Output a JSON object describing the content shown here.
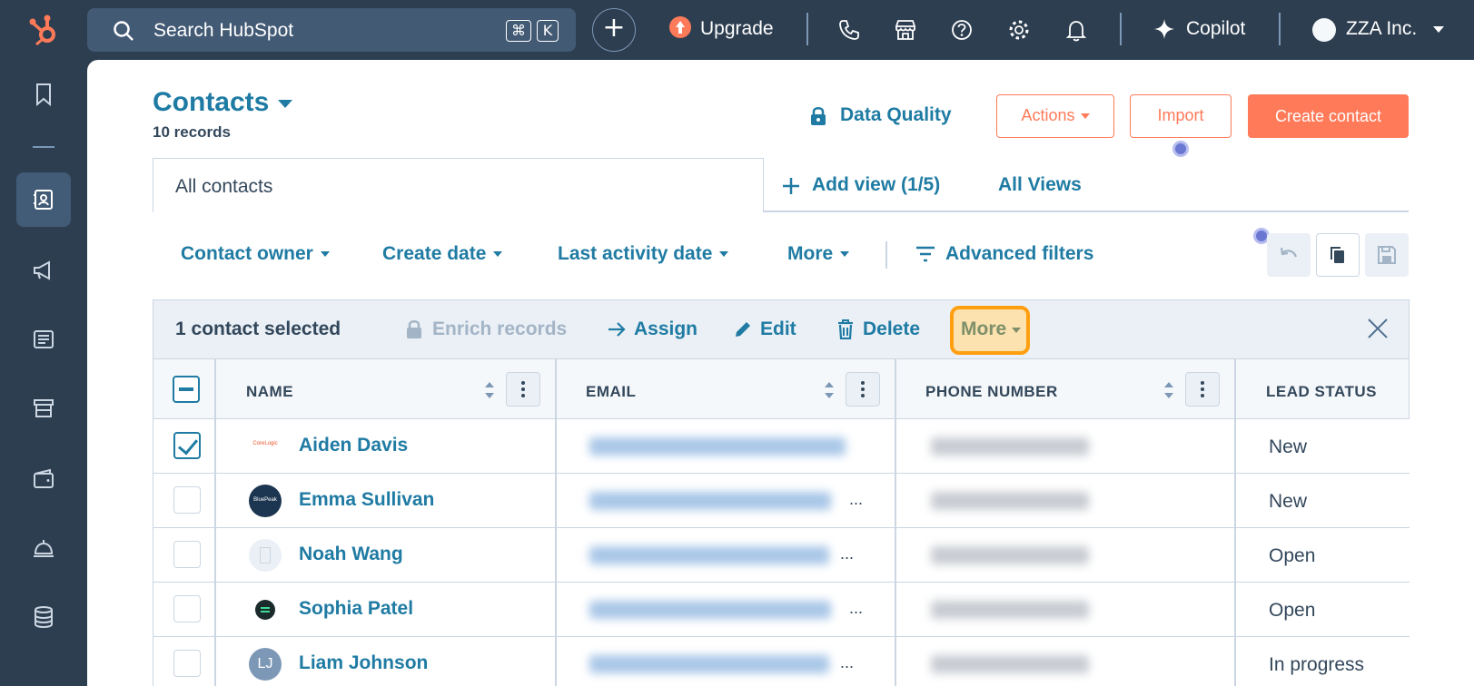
{
  "topbar": {
    "search_placeholder": "Search HubSpot",
    "kbd_cmd": "⌘",
    "kbd_k": "K",
    "upgrade_label": "Upgrade",
    "copilot_label": "Copilot",
    "account_label": "ZZA Inc."
  },
  "header": {
    "title": "Contacts",
    "records": "10 records",
    "data_quality": "Data Quality",
    "actions": "Actions",
    "import": "Import",
    "create": "Create contact"
  },
  "views": {
    "active": "All contacts",
    "add_view": "Add view (1/5)",
    "all_views": "All Views"
  },
  "filters": {
    "owner": "Contact owner",
    "create_date": "Create date",
    "last_activity": "Last activity date",
    "more": "More",
    "advanced": "Advanced filters"
  },
  "selection": {
    "count": "1 contact selected",
    "enrich": "Enrich records",
    "assign": "Assign",
    "edit": "Edit",
    "delete": "Delete",
    "more": "More"
  },
  "table": {
    "columns": [
      "NAME",
      "EMAIL",
      "PHONE NUMBER",
      "LEAD STATUS"
    ],
    "rows": [
      {
        "name": "Aiden Davis",
        "status": "New",
        "checked": true,
        "avatar": "logo-corelogic",
        "ellipsis": ""
      },
      {
        "name": "Emma Sullivan",
        "status": "New",
        "checked": false,
        "avatar": "logo-bluepeak",
        "ellipsis": "..."
      },
      {
        "name": "Noah Wang",
        "status": "Open",
        "checked": false,
        "avatar": "logo-building",
        "ellipsis": "..."
      },
      {
        "name": "Sophia Patel",
        "status": "Open",
        "checked": false,
        "avatar": "logo-green",
        "ellipsis": "..."
      },
      {
        "name": "Liam Johnson",
        "status": "In progress",
        "checked": false,
        "avatar": "initials",
        "initials": "LJ",
        "ellipsis": "..."
      }
    ]
  },
  "colors": {
    "brand_orange": "#ff7a59",
    "link_blue": "#1f7ba3",
    "nav_bg": "#2d3e50",
    "highlight": "#ff9f10"
  }
}
